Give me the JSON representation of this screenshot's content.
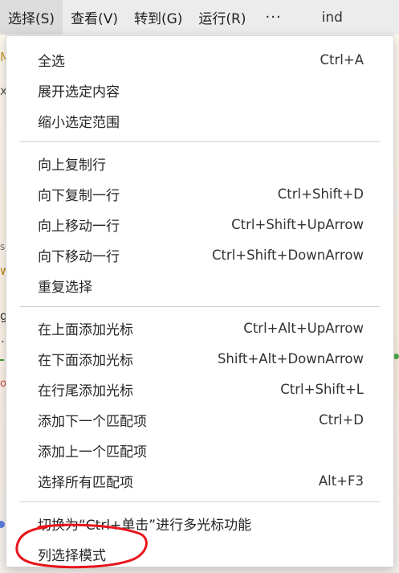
{
  "menubar": {
    "items": [
      {
        "label": "选择(S)"
      },
      {
        "label": "查看(V)"
      },
      {
        "label": "转到(G)"
      },
      {
        "label": "运行(R)"
      },
      {
        "label": "···"
      },
      {
        "label": "ind"
      }
    ]
  },
  "menu": {
    "groups": [
      [
        {
          "label": "全选",
          "shortcut": "Ctrl+A"
        },
        {
          "label": "展开选定内容",
          "shortcut": ""
        },
        {
          "label": "缩小选定范围",
          "shortcut": ""
        }
      ],
      [
        {
          "label": "向上复制行",
          "shortcut": ""
        },
        {
          "label": "向下复制一行",
          "shortcut": "Ctrl+Shift+D"
        },
        {
          "label": "向上移动一行",
          "shortcut": "Ctrl+Shift+UpArrow"
        },
        {
          "label": "向下移动一行",
          "shortcut": "Ctrl+Shift+DownArrow"
        },
        {
          "label": "重复选择",
          "shortcut": ""
        }
      ],
      [
        {
          "label": "在上面添加光标",
          "shortcut": "Ctrl+Alt+UpArrow"
        },
        {
          "label": "在下面添加光标",
          "shortcut": "Shift+Alt+DownArrow"
        },
        {
          "label": "在行尾添加光标",
          "shortcut": "Ctrl+Shift+L"
        },
        {
          "label": "添加下一个匹配项",
          "shortcut": "Ctrl+D"
        },
        {
          "label": "添加上一个匹配项",
          "shortcut": ""
        },
        {
          "label": "选择所有匹配项",
          "shortcut": "Alt+F3"
        }
      ],
      [
        {
          "label": "切换为“Ctrl+单击”进行多光标功能",
          "shortcut": ""
        },
        {
          "label": "列选择模式",
          "shortcut": ""
        }
      ]
    ]
  },
  "background": {
    "glyphs": [
      "M",
      "x",
      "s",
      "w",
      "g",
      ".",
      "o"
    ]
  },
  "colors": {
    "menubar_bg": "#ececec",
    "menubar_active": "#dcdcdc",
    "menu_bg": "#ffffff",
    "separator": "#cfcfcf",
    "annotation": "#e8141c"
  }
}
